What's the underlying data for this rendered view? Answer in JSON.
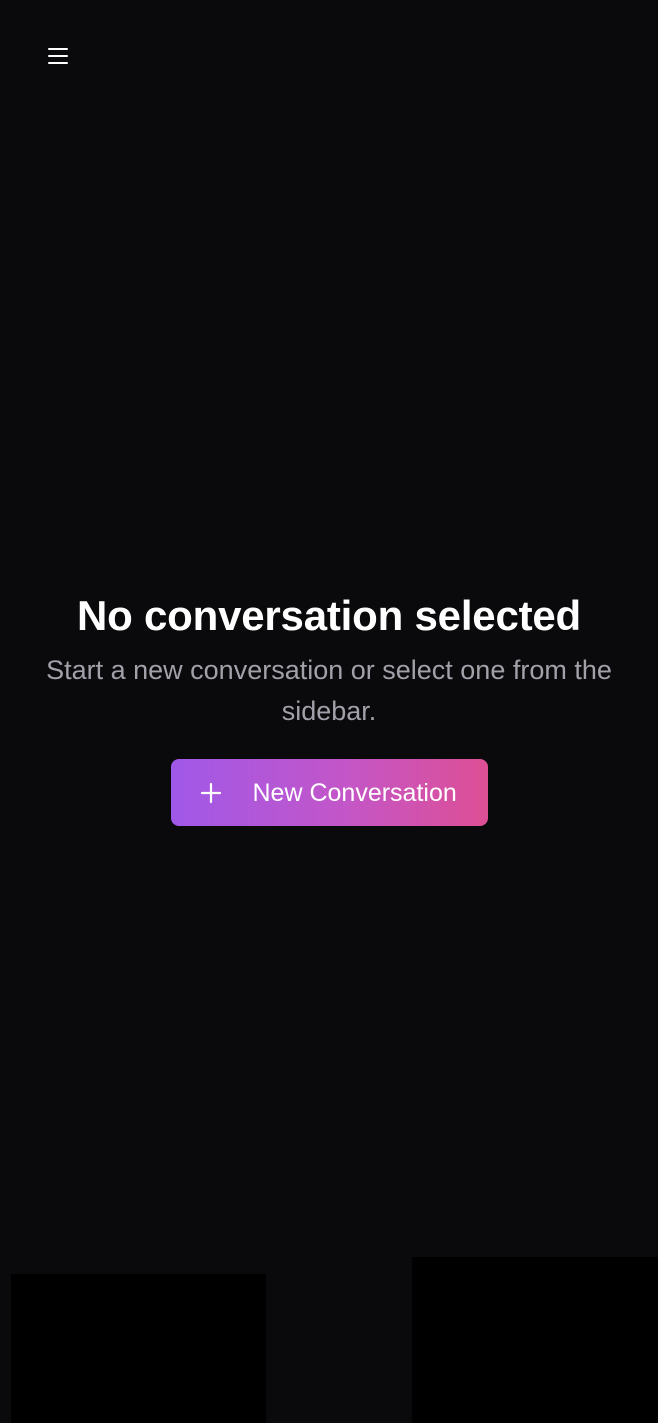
{
  "header": {
    "menu_icon": "hamburger-menu-icon"
  },
  "empty_state": {
    "title": "No conversation selected",
    "subtitle": "Start a new conversation or select one from the sidebar.",
    "new_button": {
      "icon": "plus-icon",
      "label": "New Conversation"
    }
  },
  "colors": {
    "background": "#0a0a0c",
    "title": "#ffffff",
    "subtitle": "#a1a1aa",
    "button_gradient_start": "#a058e8",
    "button_gradient_end": "#de4f94"
  }
}
